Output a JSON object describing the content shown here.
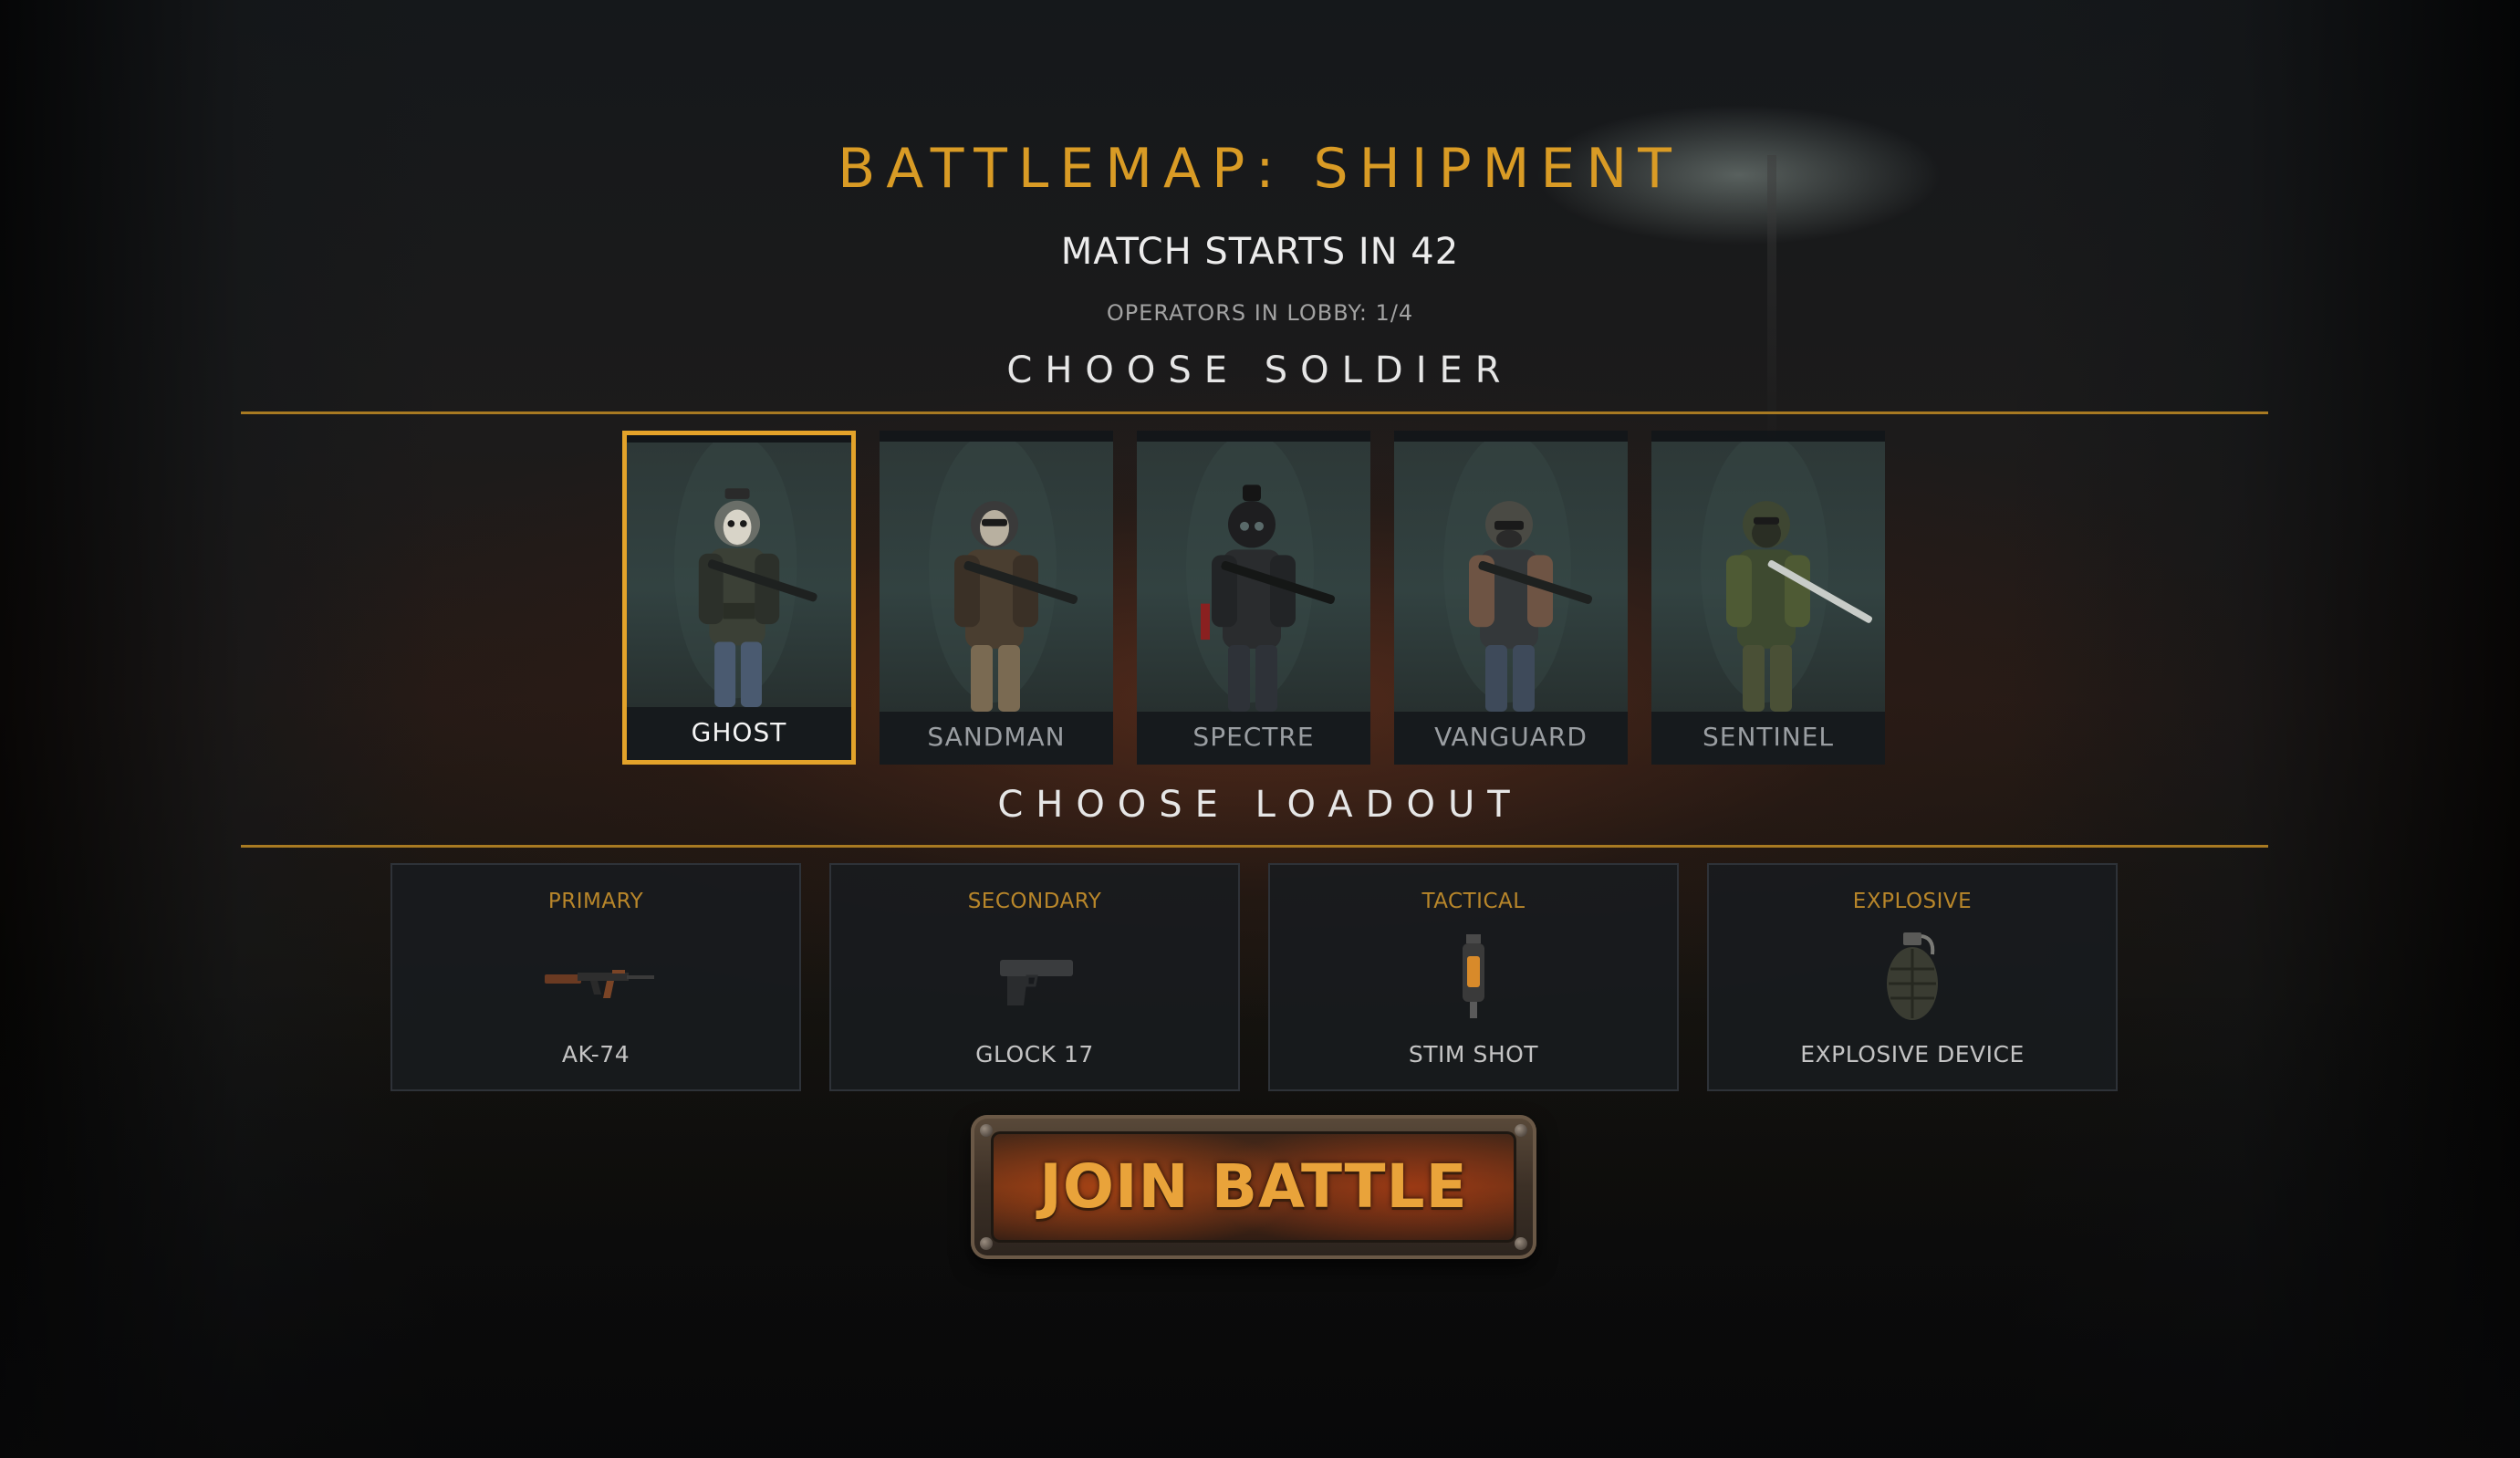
{
  "header": {
    "title": "BATTLEMAP: SHIPMENT",
    "countdown": "MATCH STARTS IN 42",
    "lobby": "OPERATORS IN LOBBY: 1/4"
  },
  "soldier_section": {
    "heading": "CHOOSE SOLDIER",
    "selected": "GHOST",
    "soldiers": [
      {
        "name": "GHOST",
        "selected": true
      },
      {
        "name": "SANDMAN",
        "selected": false
      },
      {
        "name": "SPECTRE",
        "selected": false
      },
      {
        "name": "VANGUARD",
        "selected": false
      },
      {
        "name": "SENTINEL",
        "selected": false
      }
    ]
  },
  "loadout_section": {
    "heading": "CHOOSE LOADOUT",
    "slots": [
      {
        "type": "PRIMARY",
        "item": "AK-74",
        "icon": "rifle-icon"
      },
      {
        "type": "SECONDARY",
        "item": "GLOCK 17",
        "icon": "pistol-icon"
      },
      {
        "type": "TACTICAL",
        "item": "STIM SHOT",
        "icon": "stim-icon"
      },
      {
        "type": "EXPLOSIVE",
        "item": "EXPLOSIVE DEVICE",
        "icon": "grenade-icon"
      }
    ]
  },
  "join_button": {
    "label": "JOIN BATTLE"
  },
  "colors": {
    "accent": "#d99b25",
    "selected_border": "#e3a32a",
    "divider": "#a87a22"
  }
}
